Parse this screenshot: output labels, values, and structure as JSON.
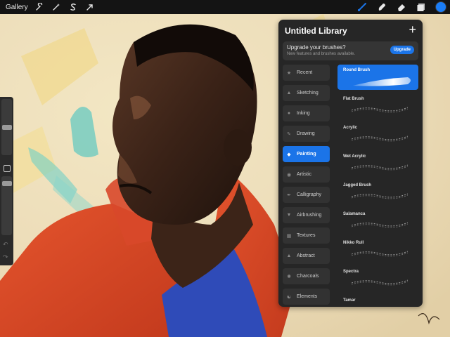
{
  "topbar": {
    "gallery_label": "Gallery",
    "left_icons": [
      "wrench-icon",
      "magic-wand-icon",
      "selection-s-icon",
      "arrow-cursor-icon"
    ],
    "right_icons": [
      "brush-icon",
      "smudge-icon",
      "eraser-icon",
      "layers-icon"
    ],
    "active_tool": "brush-icon",
    "current_color": "#1a7cf5"
  },
  "sidebar": {
    "brush_size_level": 0.5,
    "opacity_level": 0.1
  },
  "panel": {
    "title": "Untitled Library",
    "upgrade": {
      "title": "Upgrade your brushes?",
      "subtitle": "New features and brushes available.",
      "button": "Upgrade"
    },
    "categories": [
      {
        "label": "Recent",
        "icon": "star-icon"
      },
      {
        "label": "Sketching",
        "icon": "pencil-tip-icon"
      },
      {
        "label": "Inking",
        "icon": "ink-drop-icon"
      },
      {
        "label": "Drawing",
        "icon": "drawing-icon"
      },
      {
        "label": "Painting",
        "icon": "paint-brush-icon"
      },
      {
        "label": "Artistic",
        "icon": "palette-icon"
      },
      {
        "label": "Calligraphy",
        "icon": "calligraphy-icon"
      },
      {
        "label": "Airbrushing",
        "icon": "airbrush-icon"
      },
      {
        "label": "Textures",
        "icon": "texture-icon"
      },
      {
        "label": "Abstract",
        "icon": "triangle-icon"
      },
      {
        "label": "Charcoals",
        "icon": "charcoal-icon"
      },
      {
        "label": "Elements",
        "icon": "yin-yang-icon"
      }
    ],
    "active_category": "Painting",
    "brushes": [
      {
        "name": "Round Brush"
      },
      {
        "name": "Flat Brush"
      },
      {
        "name": "Acrylic"
      },
      {
        "name": "Wet Acrylic"
      },
      {
        "name": "Jagged Brush"
      },
      {
        "name": "Salamanca"
      },
      {
        "name": "Nikko Rull"
      },
      {
        "name": "Spectra"
      },
      {
        "name": "Tamar"
      }
    ],
    "active_brush": "Round Brush"
  },
  "colors": {
    "accent": "#1b74e8",
    "panel_bg": "#262626",
    "topbar_bg": "#141414"
  }
}
